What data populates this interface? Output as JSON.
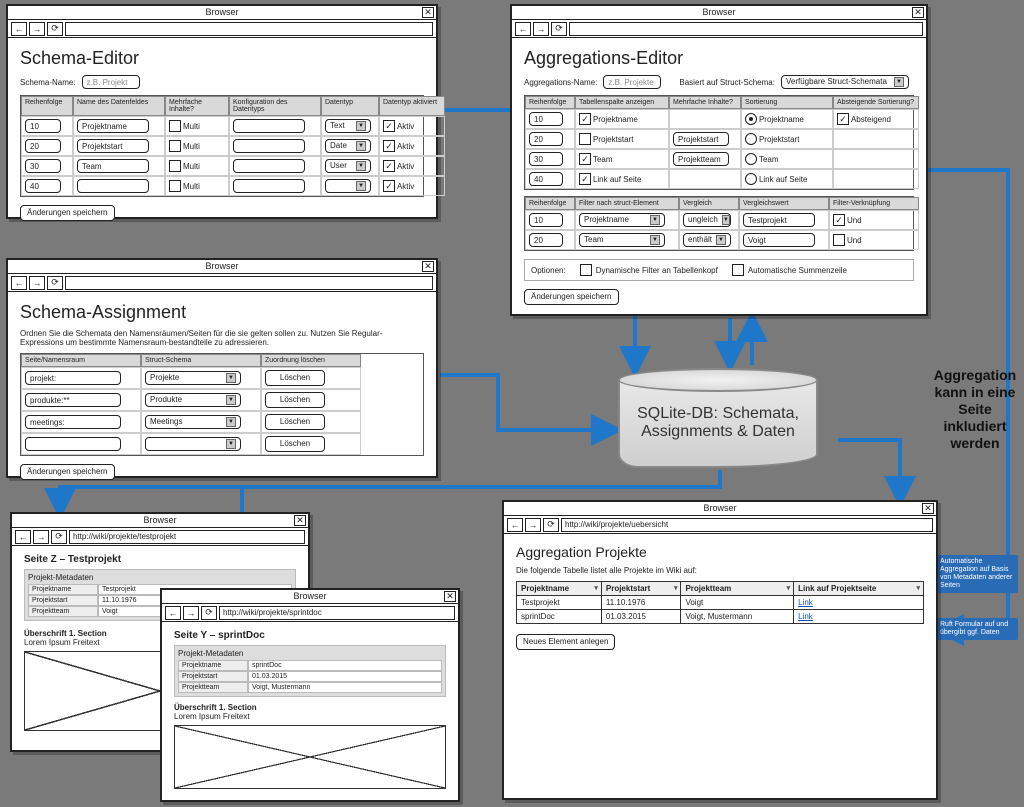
{
  "browser_title": "Browser",
  "db": {
    "line1": "SQLite-DB: Schemata,",
    "line2": "Assignments & Daten"
  },
  "annotation_right": "Aggregation kann in eine Seite inkludiert werden",
  "tooltip1": "Automatische Aggregation auf Basis von Metadaten anderer Seiten",
  "tooltip2": "Ruft Formular auf und übergibt ggf. Daten",
  "schema_editor": {
    "title": "Schema-Editor",
    "name_label": "Schema-Name:",
    "name_placeholder": "z.B. Projekt",
    "save": "Änderungen speichern",
    "headers": [
      "Reihenfolge",
      "Name des Datenfeldes",
      "Mehrfache Inhalte?",
      "Konfiguration des Datentyps",
      "Datentyp",
      "Datentyp aktiviert"
    ],
    "rows": [
      {
        "order": "10",
        "name": "Projektname",
        "multi": false,
        "cfg": "",
        "type": "Text",
        "active": true
      },
      {
        "order": "20",
        "name": "Projektstart",
        "multi": false,
        "cfg": "",
        "type": "Date",
        "active": true
      },
      {
        "order": "30",
        "name": "Team",
        "multi": false,
        "cfg": "",
        "type": "User",
        "active": true
      },
      {
        "order": "40",
        "name": "",
        "multi": false,
        "cfg": "",
        "type": "",
        "active": true
      }
    ],
    "multi_label": "Multi",
    "active_label": "Aktiv"
  },
  "schema_assignment": {
    "title": "Schema-Assignment",
    "intro": "Ordnen Sie die Schemata den Namensräumen/Seiten für die sie gelten sollen zu. Nutzen Sie Regular-Expressions um bestimmte Namensraum-bestandteile zu adressieren.",
    "headers": [
      "Seite/Namensraum",
      "Struct-Schema",
      "Zuordnung löschen"
    ],
    "rows": [
      {
        "ns": "projekt:",
        "schema": "Projekte",
        "del": "Löschen"
      },
      {
        "ns": "produkte:**",
        "schema": "Produkte",
        "del": "Löschen"
      },
      {
        "ns": "meetings:",
        "schema": "Meetings",
        "del": "Löschen"
      },
      {
        "ns": "",
        "schema": "",
        "del": "Löschen"
      }
    ],
    "save": "Änderungen speichern"
  },
  "agg_editor": {
    "title": "Aggregations-Editor",
    "name_label": "Aggregations-Name:",
    "name_placeholder": "z.B. Projekte",
    "based_label": "Basiert auf Struct-Schema:",
    "based_value": "Verfügbare Struct-Schemata",
    "save": "Änderungen speichern",
    "tbl1_headers": [
      "Reihenfolge",
      "Tabellenspalte anzeigen",
      "Mehrfache Inhalte?",
      "Sortierung",
      "Absteigende Sortierung?"
    ],
    "tbl1_rows": [
      {
        "order": "10",
        "col": "Projektname",
        "colchk": true,
        "multi": "",
        "sort": "Projektname",
        "sorton": true,
        "desc": "Absteigend",
        "descchk": true
      },
      {
        "order": "20",
        "col": "Projektstart",
        "colchk": false,
        "multi": "Projektstart",
        "sort": "Projektstart",
        "sorton": false,
        "desc": "",
        "descchk": false
      },
      {
        "order": "30",
        "col": "Team",
        "colchk": true,
        "multi": "Projektteam",
        "sort": "Team",
        "sorton": false,
        "desc": "",
        "descchk": false
      },
      {
        "order": "40",
        "col": "Link auf Seite",
        "colchk": true,
        "multi": "",
        "sort": "Link auf Seite",
        "sorton": false,
        "desc": "",
        "descchk": false
      }
    ],
    "tbl2_headers": [
      "Reihenfolge",
      "Filter nach struct-Element",
      "Vergleich",
      "Vergleichswert",
      "Filter-Verknüpfung"
    ],
    "tbl2_rows": [
      {
        "order": "10",
        "filter": "Projektname",
        "cmp": "ungleich",
        "val": "Testprojekt",
        "link": "Und",
        "linkchk": true
      },
      {
        "order": "20",
        "filter": "Team",
        "cmp": "enthält",
        "val": "Voigt",
        "link": "Und",
        "linkchk": false
      }
    ],
    "options_label": "Optionen:",
    "opt1": "Dynamische Filter an Tabellenkopf",
    "opt2": "Automatische Summenzeile"
  },
  "page_z": {
    "url": "http://wiki/projekte/testprojekt",
    "title": "Seite Z – Testprojekt",
    "meta_label": "Projekt-Metadaten",
    "rows": [
      [
        "Projektname",
        "Testprojekt"
      ],
      [
        "Projektstart",
        "11.10.1976"
      ],
      [
        "Projektteam",
        "Voigt"
      ]
    ],
    "section": "Überschrift 1. Section",
    "lorem": "Lorem Ipsum Freitext"
  },
  "page_y": {
    "url": "http://wiki/projekte/sprintdoc",
    "title": "Seite Y – sprintDoc",
    "meta_label": "Projekt-Metadaten",
    "rows": [
      [
        "Projektname",
        "sprintDoc"
      ],
      [
        "Projektstart",
        "01.03.2015"
      ],
      [
        "Projektteam",
        "Voigt, Mustermann"
      ]
    ],
    "section": "Überschrift 1. Section",
    "lorem": "Lorem Ipsum Freitext"
  },
  "agg_page": {
    "url": "http://wiki/projekte/uebersicht",
    "title": "Aggregation Projekte",
    "intro": "Die folgende Tabelle listet alle Projekte im Wiki auf:",
    "headers": [
      "Projektname",
      "Projektstart",
      "Projektteam",
      "Link auf Projektseite"
    ],
    "rows": [
      [
        "Testprojekt",
        "11.10.1976",
        "Voigt",
        "Link"
      ],
      [
        "sprintDoc",
        "01.03.2015",
        "Voigt, Mustermann",
        "Link"
      ]
    ],
    "new_btn": "Neues Element anlegen"
  }
}
